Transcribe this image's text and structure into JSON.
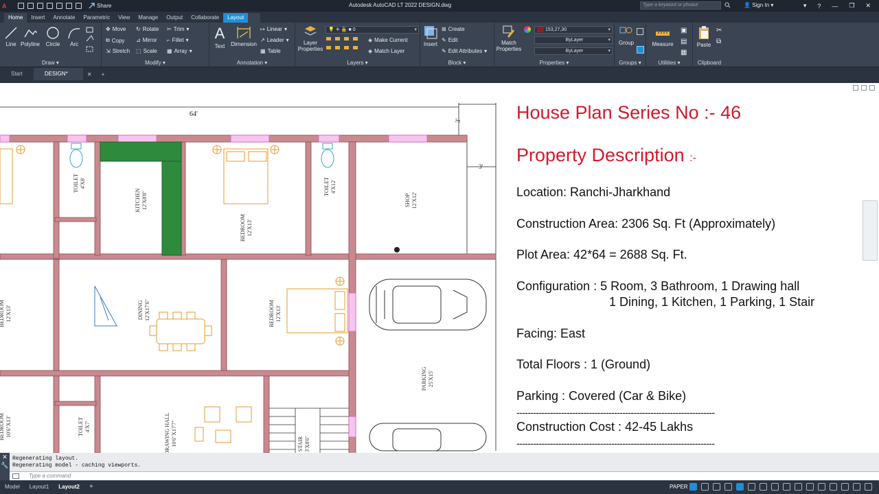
{
  "titlebar": {
    "app_logo": "A",
    "share_label": "Share",
    "title": "Autodesk AutoCAD LT 2022   DESIGN.dwg",
    "search_placeholder": "Type a keyword or phrase",
    "signin_label": "Sign In"
  },
  "ribbon_tabs": [
    "Home",
    "Insert",
    "Annotate",
    "Parametric",
    "View",
    "Manage",
    "Output",
    "Collaborate",
    "Layout"
  ],
  "ribbon": {
    "draw": {
      "title": "Draw",
      "line": "Line",
      "polyline": "Polyline",
      "circle": "Circle",
      "arc": "Arc"
    },
    "modify": {
      "title": "Modify",
      "move": "Move",
      "rotate": "Rotate",
      "trim": "Trim",
      "copy": "Copy",
      "mirror": "Mirror",
      "fillet": "Fillet",
      "stretch": "Stretch",
      "scale": "Scale",
      "array": "Array"
    },
    "annotation": {
      "title": "Annotation",
      "text": "Text",
      "dimension": "Dimension",
      "linear": "Linear",
      "leader": "Leader",
      "table": "Table"
    },
    "layers": {
      "title": "Layers",
      "layer_properties_1": "Layer",
      "layer_properties_2": "Properties",
      "layer_value": "0",
      "make_current": "Make Current",
      "match_layer": "Match Layer"
    },
    "block": {
      "title": "Block",
      "insert": "Insert",
      "create": "Create",
      "edit": "Edit",
      "edit_attributes": "Edit Attributes"
    },
    "properties": {
      "title": "Properties",
      "match_1": "Match",
      "match_2": "Properties",
      "color_value": "153,27,30",
      "linetype_value": "ByLayer",
      "lineweight_value": "ByLayer"
    },
    "groups": {
      "title": "Groups",
      "group": "Group"
    },
    "utilities": {
      "title": "Utilities",
      "measure": "Measure"
    },
    "clipboard": {
      "title": "Clipboard",
      "paste": "Paste"
    }
  },
  "doc_tabs": {
    "start": "Start",
    "design": "DESIGN*"
  },
  "plan": {
    "dim_64": "64'",
    "dim_3a": "3'",
    "dim_3b": "3'",
    "rooms": [
      {
        "name": "TOILET",
        "size": "4'X8'"
      },
      {
        "name": "KITCHEN",
        "size": "12'X8'8\""
      },
      {
        "name": "BEDROOM",
        "size": "12'X13'"
      },
      {
        "name": "TOILET",
        "size": "4'X12'"
      },
      {
        "name": "SHOP",
        "size": "12'X12'"
      },
      {
        "name": "BEDROOM",
        "size": "12'X13'"
      },
      {
        "name": "DINING",
        "size": "12'X17'6\""
      },
      {
        "name": "BEDROOM",
        "size": "12'X13'"
      },
      {
        "name": "PARKING",
        "size": "25'X15'"
      },
      {
        "name": "BEDROOM",
        "size": "10'6\"X13'"
      },
      {
        "name": "TOILET",
        "size": "4'X7'"
      },
      {
        "name": "DRAWING HALL",
        "size": "10'6\"X17'7\""
      },
      {
        "name": "STAIR",
        "size": "3'X8'6\""
      }
    ]
  },
  "description": {
    "title": "House Plan Series No :- 46",
    "subtitle": "Property Description",
    "subtitle_suffix": ":-",
    "location": "Location: Ranchi-Jharkhand",
    "construction_area": "Construction Area: 2306 Sq. Ft (Approximately)",
    "plot_area": "Plot Area: 42*64 = 2688  Sq. Ft.",
    "configuration_1": "Configuration : 5 Room,  3 Bathroom, 1 Drawing hall",
    "configuration_2": "1 Dining, 1 Kitchen, 1 Parking, 1 Stair",
    "facing": "Facing: East",
    "floors": "Total Floors : 1 (Ground)",
    "parking": "Parking :  Covered (Car & Bike)",
    "divider": "-----------------------------------------------------------------------",
    "cost": "Construction Cost : 42-45 Lakhs"
  },
  "command": {
    "history_1": "Regenerating layout.",
    "history_2": "Regenerating model - caching viewports.",
    "placeholder": "Type a command"
  },
  "status": {
    "tabs": [
      "Model",
      "Layout1",
      "Layout2"
    ],
    "active_tab": "Layout2",
    "paper": "PAPER"
  },
  "colors": {
    "wall": "#c98a8f",
    "wall_dark": "#8c4a52",
    "furniture": "#e89a2e",
    "kitchen": "#2e8b3e",
    "window": "#d65bc7",
    "title_red": "#d1192b",
    "accent": "#1f8fd6"
  }
}
